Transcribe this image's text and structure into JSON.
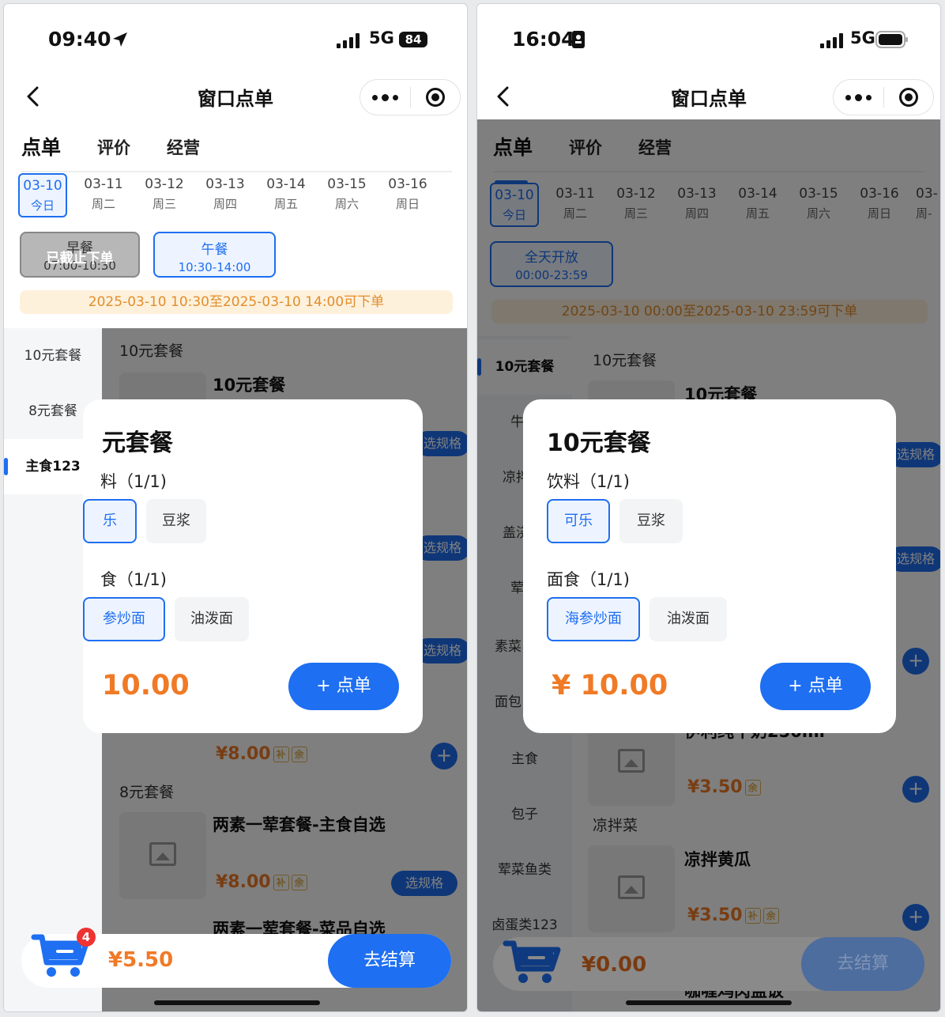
{
  "left": {
    "status": {
      "time": "09:40",
      "network": "5G",
      "battery": "84"
    },
    "nav": {
      "title": "窗口点单"
    },
    "tabs": [
      "点单",
      "评价",
      "经营"
    ],
    "dates": [
      {
        "date": "03-10",
        "day": "今日"
      },
      {
        "date": "03-11",
        "day": "周二"
      },
      {
        "date": "03-12",
        "day": "周三"
      },
      {
        "date": "03-13",
        "day": "周四"
      },
      {
        "date": "03-14",
        "day": "周五"
      },
      {
        "date": "03-15",
        "day": "周六"
      },
      {
        "date": "03-16",
        "day": "周日"
      }
    ],
    "meals": [
      {
        "name": "早餐",
        "time": "07:00-10:30",
        "overlay": "已截止下单"
      },
      {
        "name": "午餐",
        "time": "10:30-14:00"
      }
    ],
    "notice": "2025-03-10 10:30至2025-03-10 14:00可下单",
    "sidebar": [
      "10元套餐",
      "8元套餐",
      "主食123"
    ],
    "menu": {
      "section1": "10元套餐",
      "item1": "10元套餐",
      "item_price": "¥8.00",
      "section2": "8元套餐",
      "item2": "两素一荤套餐-主食自选",
      "item2_price": "¥8.00",
      "item3": "两素一荤套餐-菜品自选",
      "spec_btn": "选规格",
      "tag1": "补",
      "tag2": "余"
    },
    "modal": {
      "title": "元套餐",
      "group1": "料（1/1)",
      "g1_opt1": "乐",
      "g1_opt2": "豆浆",
      "group2": "食（1/1)",
      "g2_opt1": "参炒面",
      "g2_opt2": "油泼面",
      "price": "10.00",
      "order": "+ 点单"
    },
    "cart": {
      "badge": "4",
      "total": "¥5.50",
      "checkout": "去结算"
    }
  },
  "right": {
    "status": {
      "time": "16:04",
      "network": "5G"
    },
    "nav": {
      "title": "窗口点单"
    },
    "tabs": [
      "点单",
      "评价",
      "经营"
    ],
    "dates": [
      {
        "date": "03-10",
        "day": "今日"
      },
      {
        "date": "03-11",
        "day": "周二"
      },
      {
        "date": "03-12",
        "day": "周三"
      },
      {
        "date": "03-13",
        "day": "周四"
      },
      {
        "date": "03-14",
        "day": "周五"
      },
      {
        "date": "03-15",
        "day": "周六"
      },
      {
        "date": "03-16",
        "day": "周日"
      },
      {
        "date": "03-",
        "day": "周-"
      }
    ],
    "meals": [
      {
        "name": "全天开放",
        "time": "00:00-23:59"
      }
    ],
    "notice": "2025-03-10 00:00至2025-03-10 23:59可下单",
    "sidebar": [
      "10元套餐",
      "牛",
      "凉拌",
      "盖浇",
      "荤",
      "素菜",
      "面包",
      "主食",
      "包子",
      "荤菜鱼类",
      "卤蛋类123"
    ],
    "menu": {
      "section1": "10元套餐",
      "item1": "10元套餐",
      "item_price": "¥3.50",
      "section2": "凉拌菜",
      "item2": "凉拌黄瓜",
      "item2_price": "¥3.50",
      "item_partial": "伊利纯牛奶250ml",
      "item_bottom": "咖喱鸡肉盖饭",
      "spec_btn": "选规格",
      "tag1": "补",
      "tag2": "余"
    },
    "modal": {
      "title": "10元套餐",
      "group1": "饮料（1/1)",
      "g1_opt1": "可乐",
      "g1_opt2": "豆浆",
      "group2": "面食（1/1)",
      "g2_opt1": "海参炒面",
      "g2_opt2": "油泼面",
      "price": "¥ 10.00",
      "order": "+ 点单"
    },
    "cart": {
      "total": "¥0.00",
      "checkout": "去结算"
    }
  }
}
